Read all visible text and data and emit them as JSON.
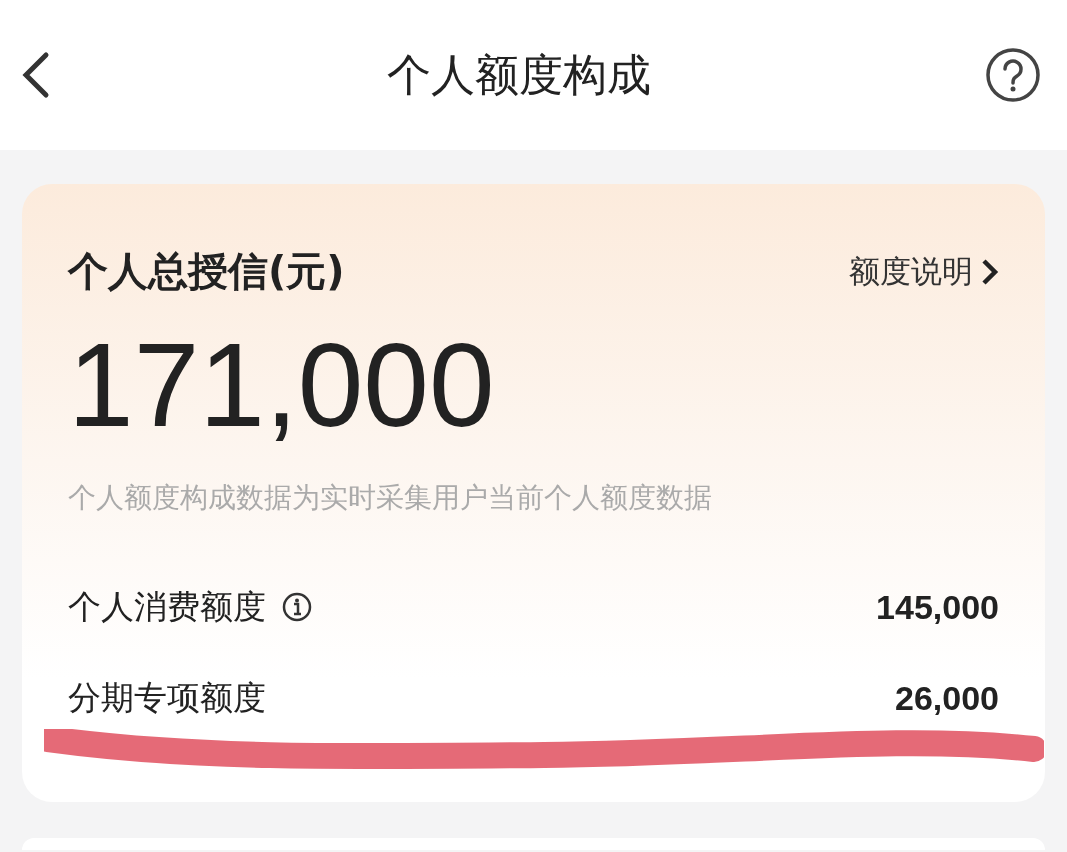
{
  "header": {
    "title": "个人额度构成"
  },
  "credit_card": {
    "title": "个人总授信(元)",
    "link": "额度说明",
    "amount": "171,000",
    "note": "个人额度构成数据为实时采集用户当前个人额度数据",
    "rows": [
      {
        "label": "个人消费额度",
        "info": true,
        "value": "145,000"
      },
      {
        "label": "分期专项额度",
        "info": false,
        "value": "26,000"
      }
    ]
  }
}
